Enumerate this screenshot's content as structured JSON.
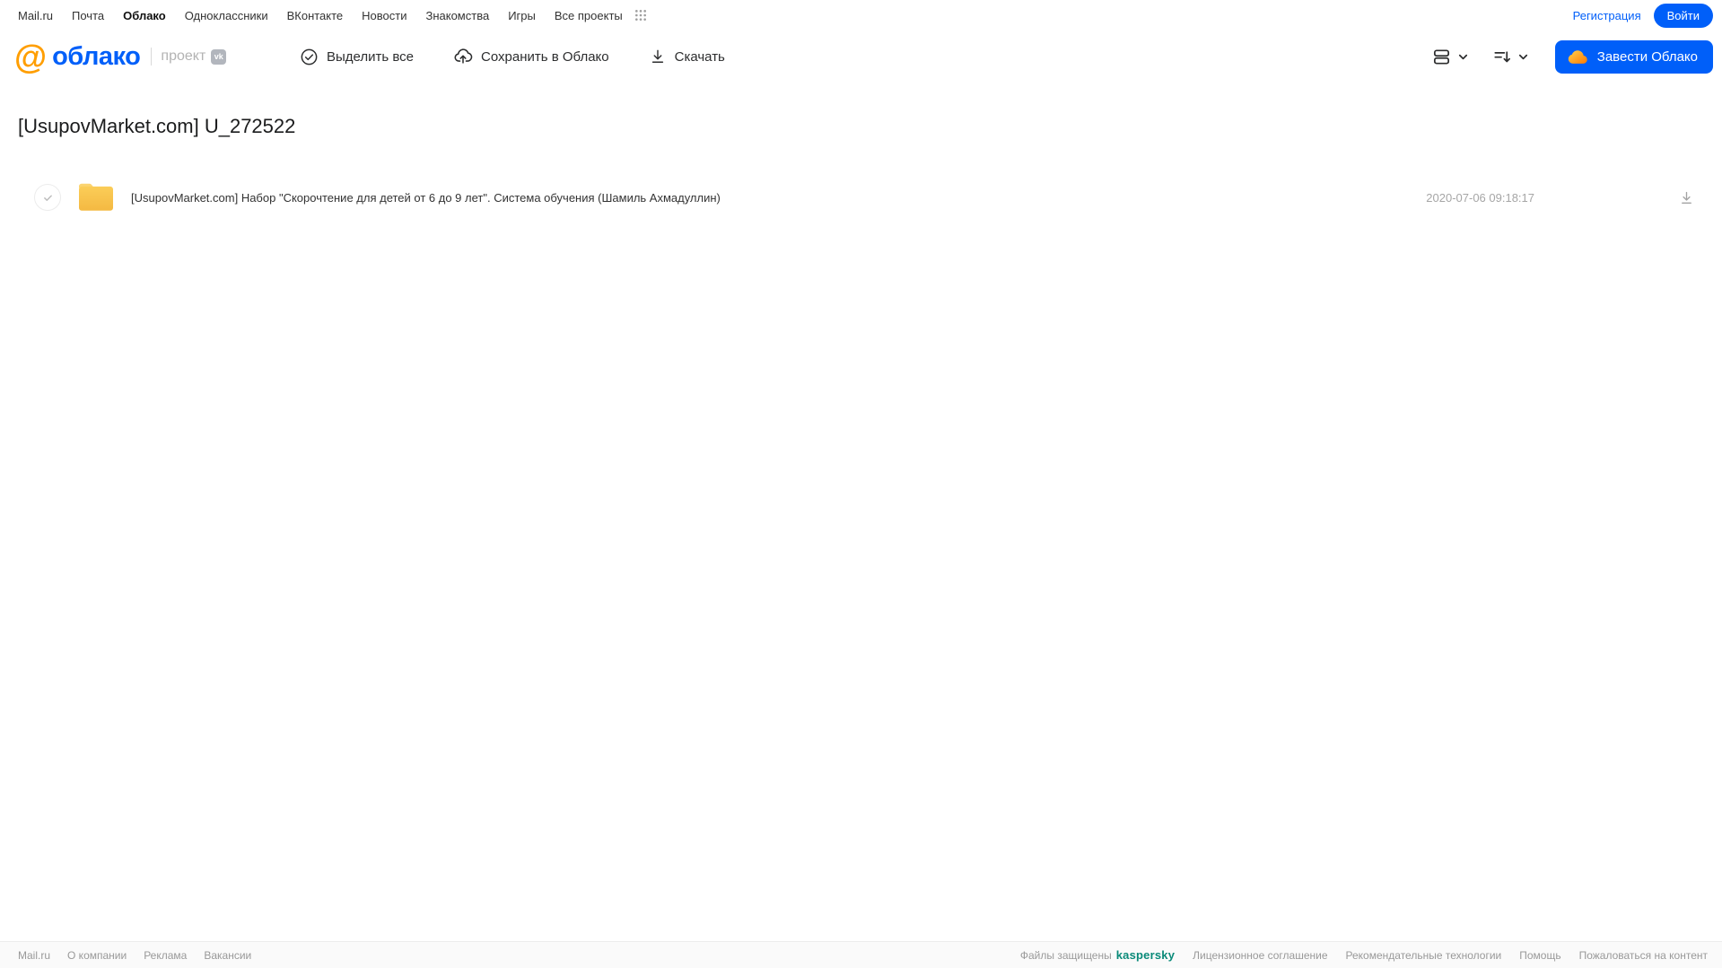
{
  "topnav": {
    "items": [
      "Mail.ru",
      "Почта",
      "Облако",
      "Одноклассники",
      "ВКонтакте",
      "Новости",
      "Знакомства",
      "Игры",
      "Все проекты"
    ],
    "active_item": "Облако"
  },
  "auth": {
    "register": "Регистрация",
    "login": "Войти"
  },
  "header": {
    "logo": "облако",
    "project": "проект",
    "vk_badge": "vk",
    "cta": "Завести Облако"
  },
  "toolbar": {
    "select_all": "Выделить все",
    "save": "Сохранить в Облако",
    "download": "Скачать"
  },
  "page": {
    "title": "[UsupovMarket.com] U_272522"
  },
  "files": [
    {
      "name": "[UsupovMarket.com] Набор \"Скорочтение для детей от 6 до 9 лет\". Система обучения (Шамиль Ахмадуллин)",
      "date": "2020-07-06 09:18:17",
      "type": "folder"
    }
  ],
  "footer": {
    "left": [
      "Mail.ru",
      "О компании",
      "Реклама",
      "Вакансии"
    ],
    "protected_label": "Файлы защищены",
    "kaspersky": "kaspersky",
    "right": [
      "Лицензионное соглашение",
      "Рекомендательные технологии",
      "Помощь",
      "Пожаловаться на контент"
    ]
  },
  "colors": {
    "accent_blue": "#005ff9",
    "logo_orange": "#ff9e00",
    "folder_yellow": "#f7c348",
    "kaspersky_green": "#0a8a79"
  }
}
